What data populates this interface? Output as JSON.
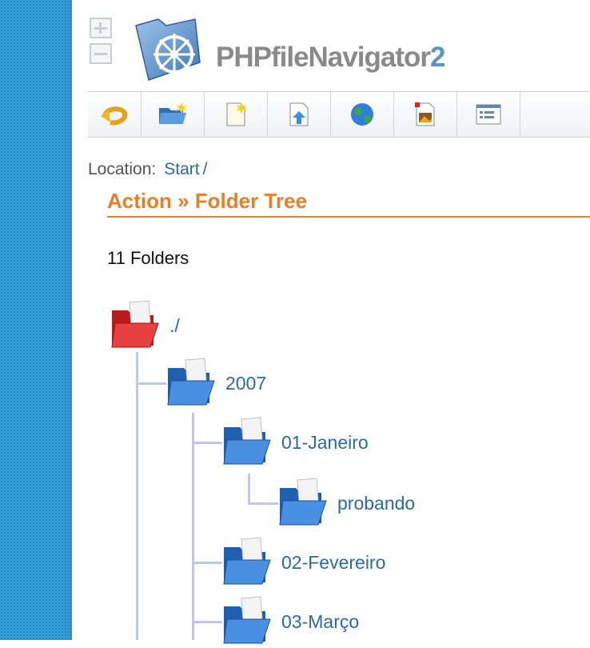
{
  "app": {
    "title_main": "PHPfileNavigator",
    "title_version": "2"
  },
  "zoom": {
    "expand": "expand-all",
    "collapse": "collapse-all"
  },
  "toolbar": {
    "icons": [
      "back-icon",
      "new-folder-icon",
      "new-file-icon",
      "upload-icon",
      "web-icon",
      "image-icon",
      "info-panel-icon"
    ]
  },
  "location": {
    "label": "Location:",
    "link": "Start",
    "separator": "/"
  },
  "section": {
    "title": "Action » Folder Tree"
  },
  "summary": {
    "count_text": "11 Folders"
  },
  "tree": {
    "nodes": [
      {
        "label": "./",
        "level": 0,
        "color": "red"
      },
      {
        "label": "2007",
        "level": 1,
        "color": "blue"
      },
      {
        "label": "01-Janeiro",
        "level": 2,
        "color": "blue"
      },
      {
        "label": "probando",
        "level": 3,
        "color": "blue"
      },
      {
        "label": "02-Fevereiro",
        "level": 2,
        "color": "blue"
      },
      {
        "label": "03-Março",
        "level": 2,
        "color": "blue"
      }
    ]
  },
  "colors": {
    "accent": "#e87f28",
    "link": "#2a6aa8",
    "side_strip": "#2f9fd6",
    "tree_line": "#c3c7e6"
  }
}
